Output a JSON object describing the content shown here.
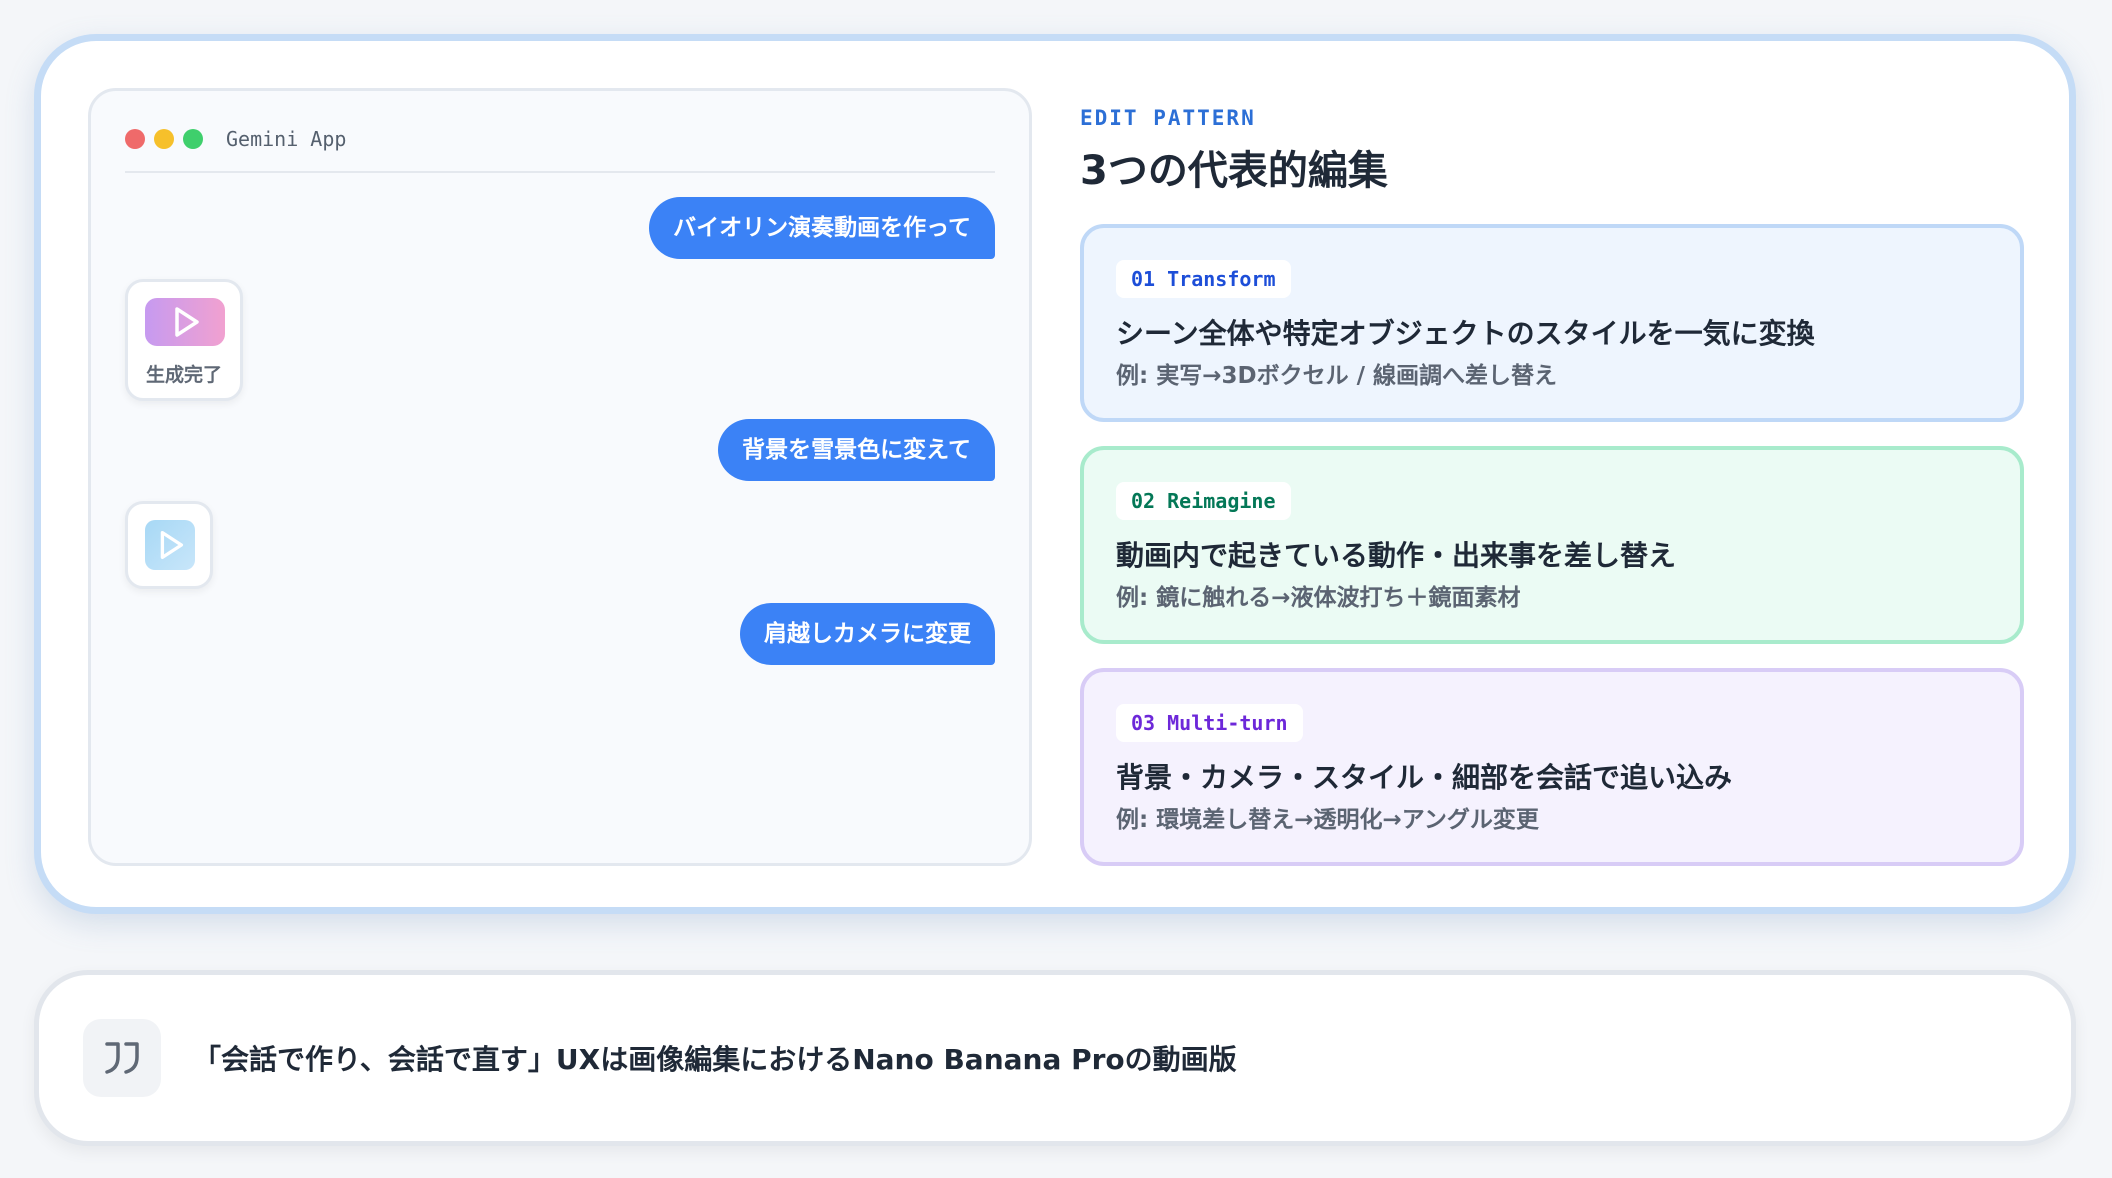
{
  "chat": {
    "app_name": "Gemini App",
    "messages": [
      "バイオリン演奏動画を作って",
      "背景を雪景色に変えて",
      "肩越しカメラに変更"
    ],
    "video_card_label": "生成完了",
    "video_icon": "play-icon"
  },
  "patterns": {
    "eyebrow": "EDIT PATTERN",
    "title": "3つの代表的編集",
    "items": [
      {
        "tag": "01 Transform",
        "title": "シーン全体や特定オブジェクトのスタイルを一気に変換",
        "example": "例: 実写→3Dボクセル / 線画調へ差し替え",
        "accent": "#1d4ed8"
      },
      {
        "tag": "02 Reimagine",
        "title": "動画内で起きている動作・出来事を差し替え",
        "example": "例: 鏡に触れる→液体波打ち＋鏡面素材",
        "accent": "#047857"
      },
      {
        "tag": "03 Multi-turn",
        "title": "背景・カメラ・スタイル・細部を会話で追い込み",
        "example": "例: 環境差し替え→透明化→アングル変更",
        "accent": "#6d28d9"
      }
    ]
  },
  "quote": {
    "icon": "quote-icon",
    "text": "「会話で作り、会話で直す」UXは画像編集におけるNano Banana Proの動画版"
  },
  "colors": {
    "bubble": "#3b82f6",
    "frame": "#c5dcf6"
  }
}
